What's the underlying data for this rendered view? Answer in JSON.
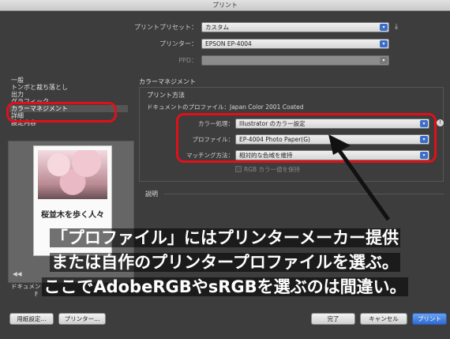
{
  "window": {
    "title": "プリント"
  },
  "top": {
    "preset_label": "プリントプリセット：",
    "preset_value": "カスタム",
    "printer_label": "プリンター：",
    "printer_value": "EPSON EP-4004",
    "ppd_label": "PPD："
  },
  "sidebar": {
    "items": [
      {
        "label": "一般"
      },
      {
        "label": "トンボと裁ち落とし"
      },
      {
        "label": "出力"
      },
      {
        "label": "グラフィック"
      },
      {
        "label": "カラーマネジメント"
      },
      {
        "label": "詳細"
      },
      {
        "label": "設定内容"
      }
    ]
  },
  "preview": {
    "caption": "桜並木を歩く人々"
  },
  "left_bottom": {
    "document_label": "ドキュメン",
    "f_label": "F"
  },
  "color_management": {
    "title": "カラーマネジメント",
    "print_method": "プリント方法",
    "doc_profile": "ドキュメントのプロファイル：Japan Color 2001 Coated",
    "color_handling_label": "カラー処理：",
    "color_handling_value": "Illustrator のカラー設定",
    "profile_label": "プロファイル：",
    "profile_value": "EP-4004 Photo Paper(G)",
    "matching_label": "マッチング方法：",
    "matching_value": "相対的な色域を維持",
    "preserve_rgb": "RGB カラー値を保持"
  },
  "description": {
    "title": "説明"
  },
  "buttons": {
    "page_setup": "用紙設定...",
    "printer": "プリンター...",
    "done": "完了",
    "cancel": "キャンセル",
    "print": "プリント"
  },
  "overlay": {
    "line1": "「プロファイル」にはプリンターメーカー提供",
    "line2": "または自作のプリンタープロファイルを選ぶ。",
    "line3": "ここでAdobeRGBやsRGBを選ぶのは間違い。"
  },
  "colors": {
    "highlight": "#e0101a",
    "accent": "#2e6bd4"
  }
}
